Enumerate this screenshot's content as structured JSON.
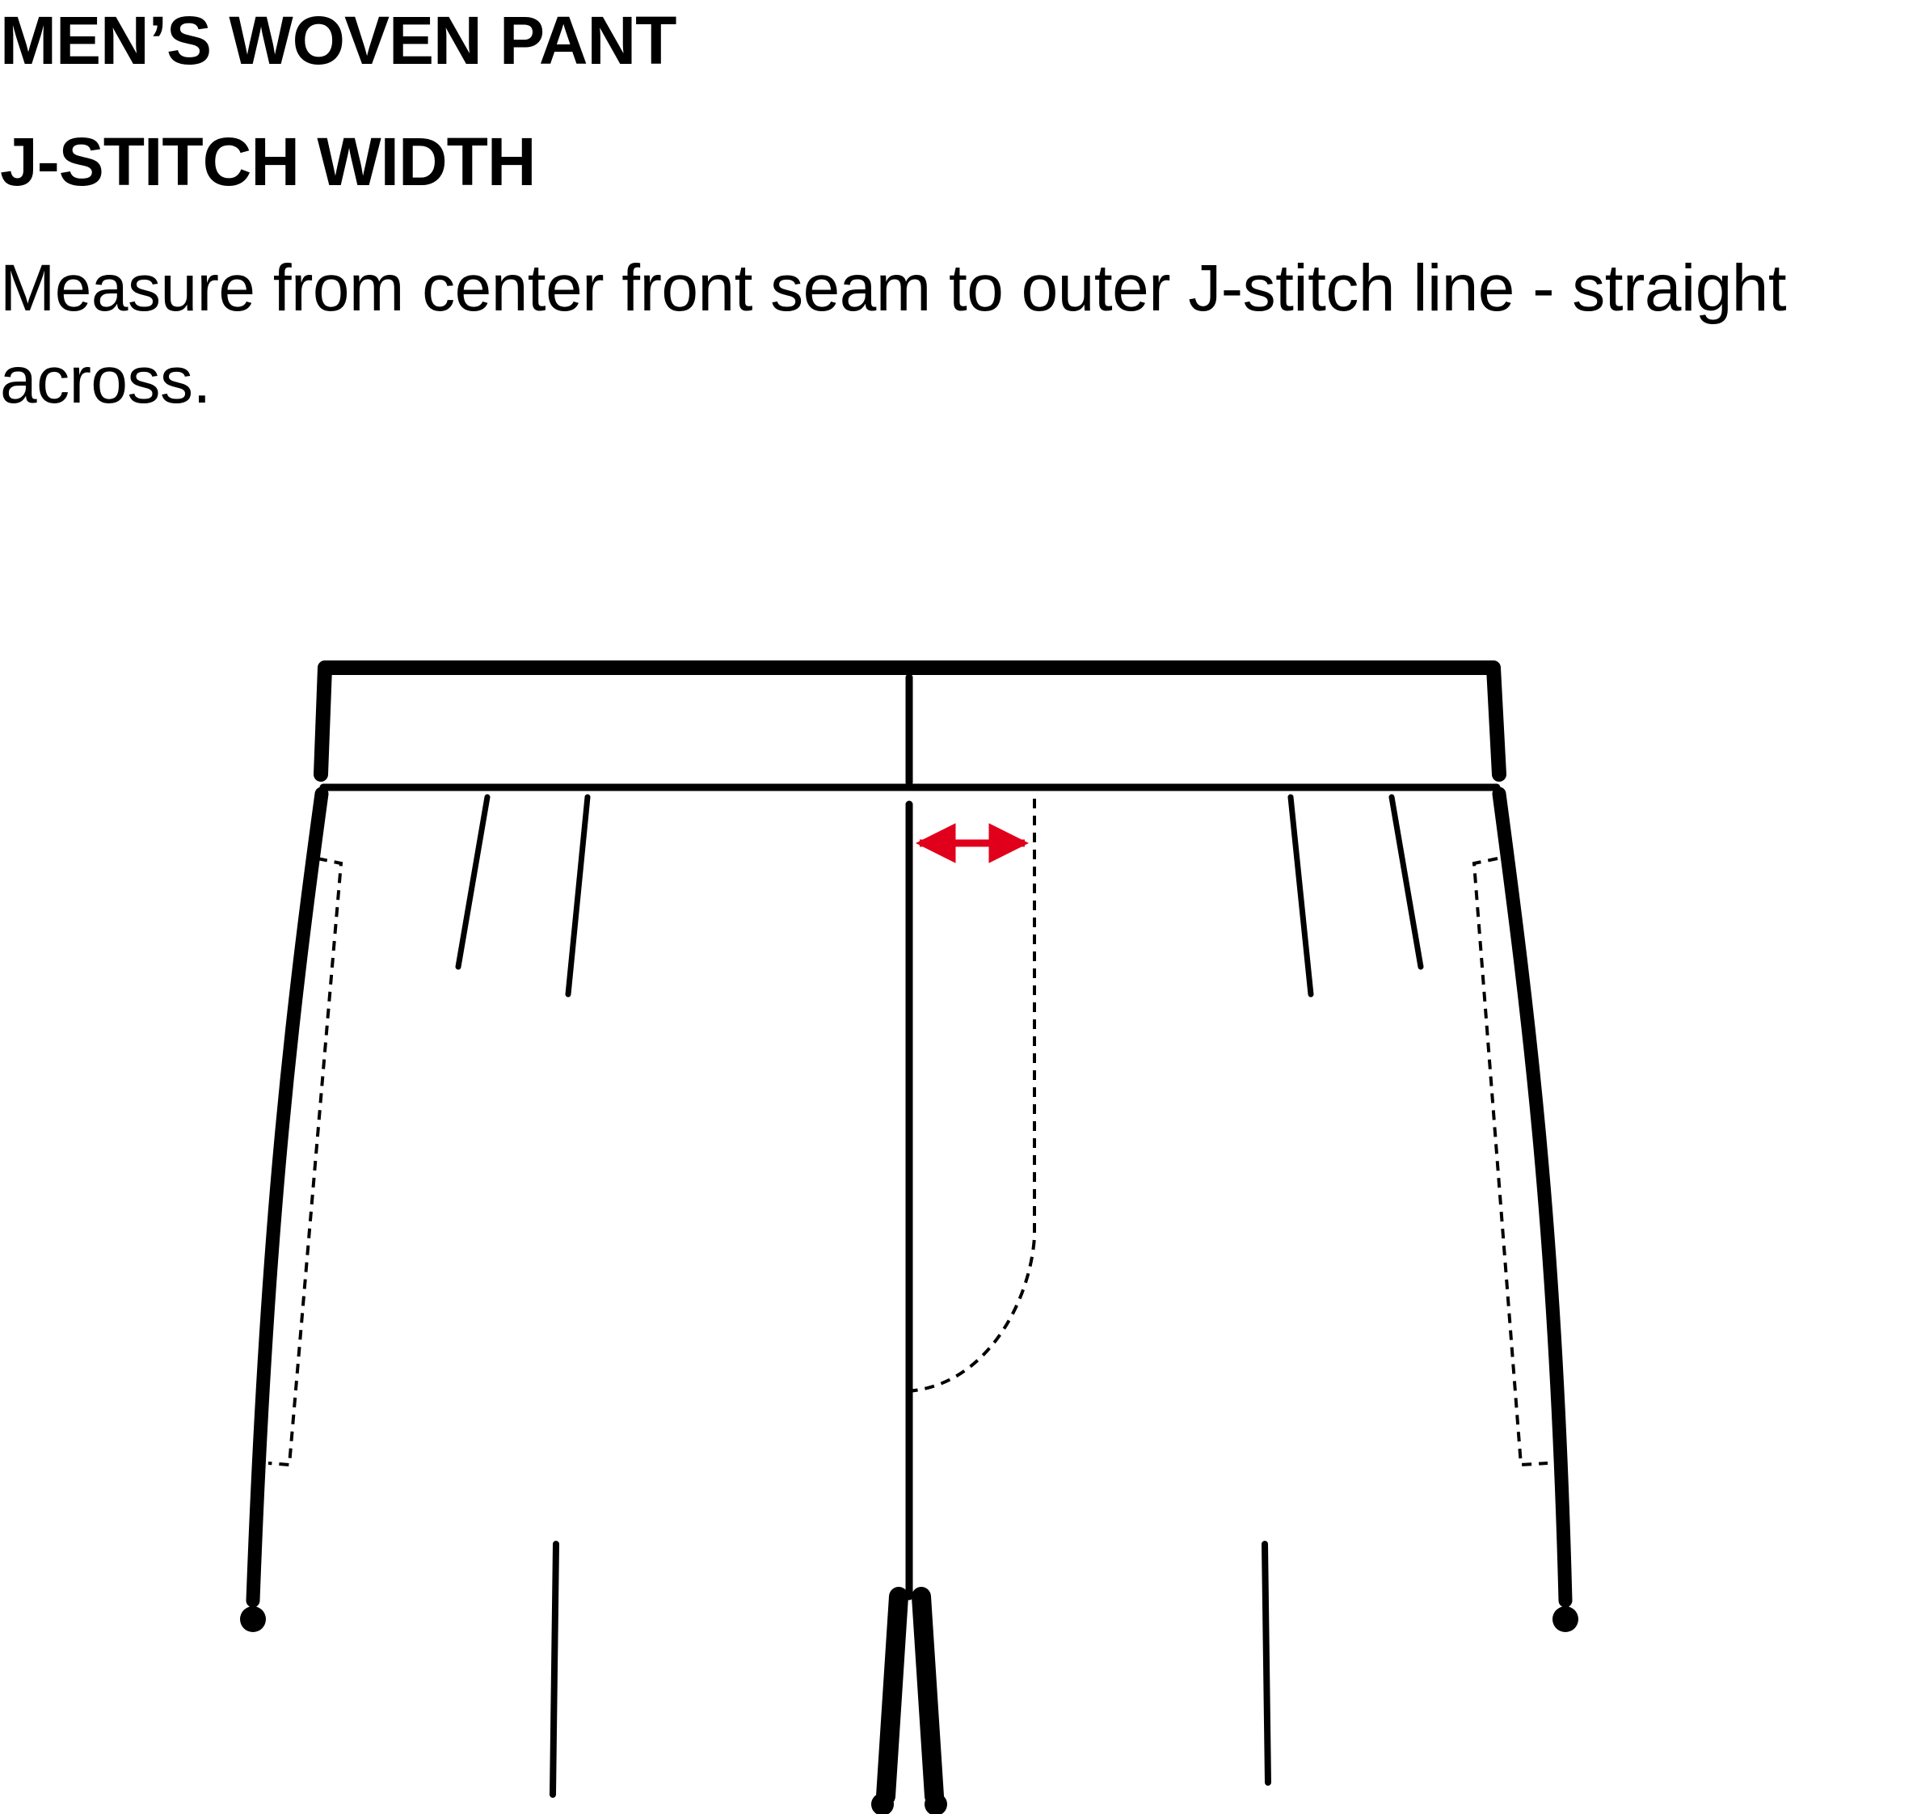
{
  "heading": {
    "title": "MEN’S WOVEN PANT",
    "subtitle": "J-STITCH WIDTH"
  },
  "instructions": {
    "text": "Measure from center front seam to outer J-stitch line - straight across."
  },
  "colors": {
    "line": "#000000",
    "measure_arrow": "#e0001b",
    "background": "#ffffff"
  },
  "diagram": {
    "subject": "front view of pant waistband and fly",
    "measurement": "J-stitch width"
  }
}
